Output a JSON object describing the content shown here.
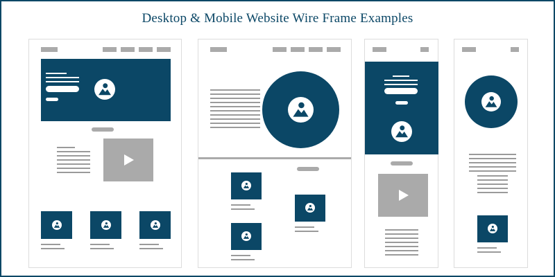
{
  "title": "Desktop & Mobile Website Wire Frame Examples",
  "colors": {
    "navy": "#0b4766",
    "gray": "#aaaaaa",
    "line": "#9a9a9a",
    "border": "#dcdcdc"
  },
  "icons": {
    "image": "image-mountain-icon",
    "video": "play-icon"
  },
  "wireframes": [
    "desktop-1",
    "desktop-2",
    "mobile-1",
    "mobile-2"
  ]
}
